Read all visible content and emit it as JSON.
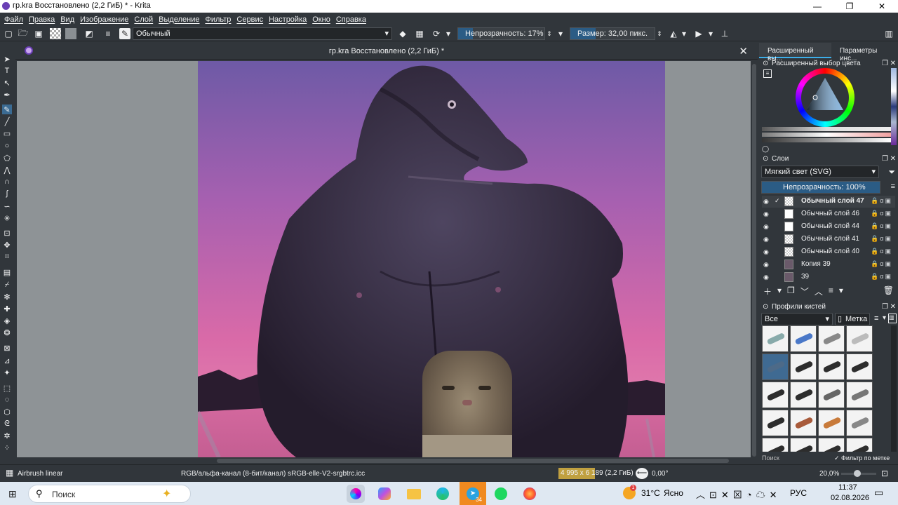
{
  "window": {
    "title": "гр.kra Восстановлено (2,2 ГиБ) * - Krita",
    "minimize": "—",
    "maximize": "❐",
    "close": "✕"
  },
  "menu": [
    "Файл",
    "Правка",
    "Вид",
    "Изображение",
    "Слой",
    "Выделение",
    "Фильтр",
    "Сервис",
    "Настройка",
    "Окно",
    "Справка"
  ],
  "toolbar": {
    "blend_mode": "Обычный",
    "opacity_label": "Непрозрачность: 17%",
    "opacity_value": 0.17,
    "size_label": "Размер: 32,00 пикс."
  },
  "document": {
    "tab_title": "гр.kra Восстановлено (2,2 ГиБ) *",
    "close": "✕"
  },
  "dock": {
    "tabs": [
      "Расширенный вы...",
      "Параметры инс..."
    ],
    "color_selector_title": "Расширенный выбор цвета",
    "layers_title": "Слои",
    "layer_blend": "Мягкий свет (SVG)",
    "layer_opacity": "Непрозрачность:  100%",
    "layers": [
      {
        "name": "Обычный слой 47",
        "active": true
      },
      {
        "name": "Обычный слой 46",
        "active": false
      },
      {
        "name": "Обычный слой 44",
        "active": false
      },
      {
        "name": "Обычный слой 41",
        "active": false
      },
      {
        "name": "Обычный слой 40",
        "active": false
      },
      {
        "name": "Копия 39",
        "active": false
      },
      {
        "name": "39",
        "active": false
      }
    ],
    "brushes_title": "Профили кистей",
    "brush_filter": "Все",
    "brush_tag": "Метка",
    "search_placeholder": "Поиск",
    "filter_by_tag": "Фильтр по метке"
  },
  "status": {
    "brush": "Airbrush linear",
    "colorspace": "RGB/альфа-канал (8-бит/канал)  sRGB-elle-V2-srgbtrc.icc",
    "dimensions": "4 995 x 6 189 (2,2 ГиБ)",
    "rotation": "0,00°",
    "zoom": "20,0%"
  },
  "taskbar": {
    "search": "Поиск",
    "weather": "31°C",
    "weather_text": "Ясно",
    "language": "РУС",
    "time": "11:37",
    "date": "02.08.2026",
    "telegram_badge": "34",
    "weather_badge": "1"
  },
  "colors": {
    "accent": "#3daee9",
    "bg": "#31363b",
    "panel": "#232629"
  }
}
